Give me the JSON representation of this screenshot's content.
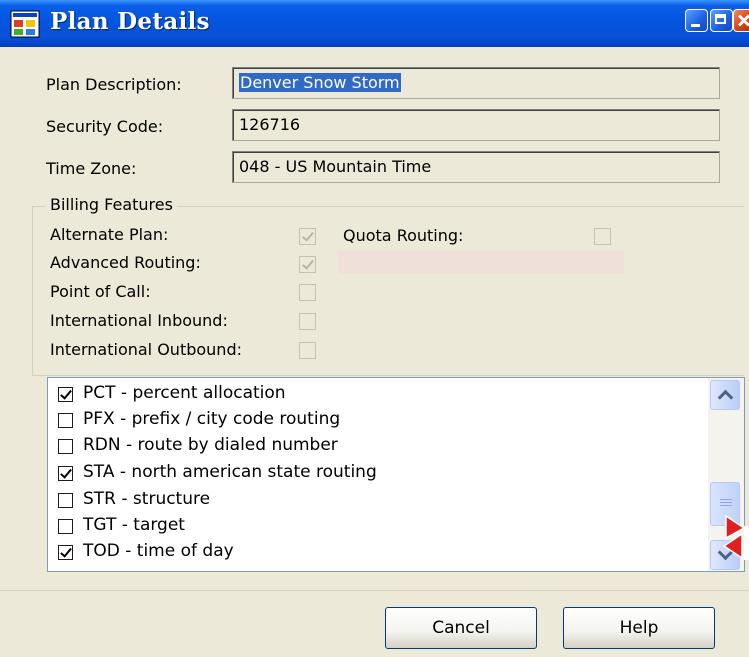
{
  "window": {
    "title": "Plan Details"
  },
  "fields": {
    "plan_description": {
      "label": "Plan Description:",
      "value": "Denver Snow Storm"
    },
    "security_code": {
      "label": "Security Code:",
      "value": "126716"
    },
    "time_zone": {
      "label": "Time Zone:",
      "value": "048 - US Mountain Time"
    }
  },
  "billing": {
    "title": "Billing Features",
    "features": [
      {
        "label": "Alternate Plan:",
        "checked": true
      },
      {
        "label": "Advanced Routing:",
        "checked": true
      },
      {
        "label": "Point of Call:",
        "checked": false
      },
      {
        "label": "International Inbound:",
        "checked": false
      },
      {
        "label": "International Outbound:",
        "checked": false
      }
    ],
    "quota_routing": {
      "label": "Quota Routing:",
      "checked": false
    }
  },
  "routing_list": [
    {
      "label": "PCT - percent allocation",
      "checked": true
    },
    {
      "label": "PFX - prefix / city code routing",
      "checked": false
    },
    {
      "label": "RDN - route by dialed number",
      "checked": false
    },
    {
      "label": "STA - north american state routing",
      "checked": true
    },
    {
      "label": "STR - structure",
      "checked": false
    },
    {
      "label": "TGT - target",
      "checked": false
    },
    {
      "label": "TOD - time of day",
      "checked": true
    }
  ],
  "buttons": {
    "cancel": "Cancel",
    "help": "Help"
  },
  "icons": {
    "app": "app-window-icon",
    "minimize": "minimize-icon",
    "maximize": "maximize-icon",
    "close": "close-icon",
    "scroll_up": "chevron-up-icon",
    "scroll_down": "chevron-down-icon"
  },
  "colors": {
    "title_bar": "#0455df",
    "selection": "#316ac5",
    "marker": "#e02020"
  }
}
